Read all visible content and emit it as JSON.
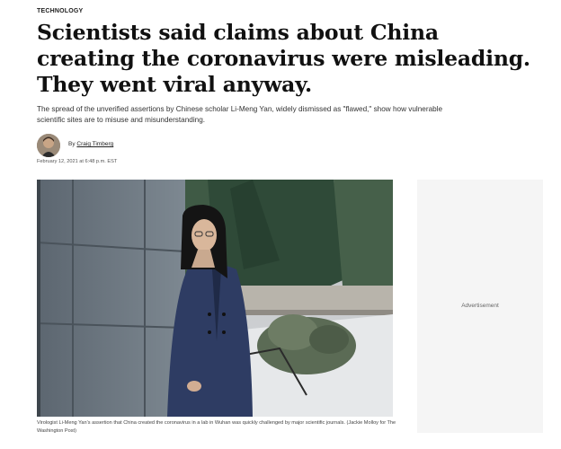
{
  "article": {
    "kicker": "TECHNOLOGY",
    "headline": "Scientists said claims about China creating the coronavirus were misleading. They went viral anyway.",
    "dek": "The spread of the unverified assertions by Chinese scholar Li-Meng Yan, widely dismissed as \"flawed,\" show how vulnerable scientific sites are to misuse and misunderstanding.",
    "byline_prefix": "By",
    "author": "Craig Timberg",
    "dateline": "February 12, 2021 at 6:48 p.m. EST",
    "caption": "Virologist Li-Meng Yan's assertion that China created the coronavirus in a lab in Wuhan was quickly challenged by major scientific journals. (Jackie Molloy for The Washington Post)"
  },
  "ad": {
    "label": "Advertisement"
  },
  "colors": {
    "text": "#111111",
    "ad_background": "#f5f5f5"
  },
  "icons": {
    "author_photo": "author-avatar"
  }
}
